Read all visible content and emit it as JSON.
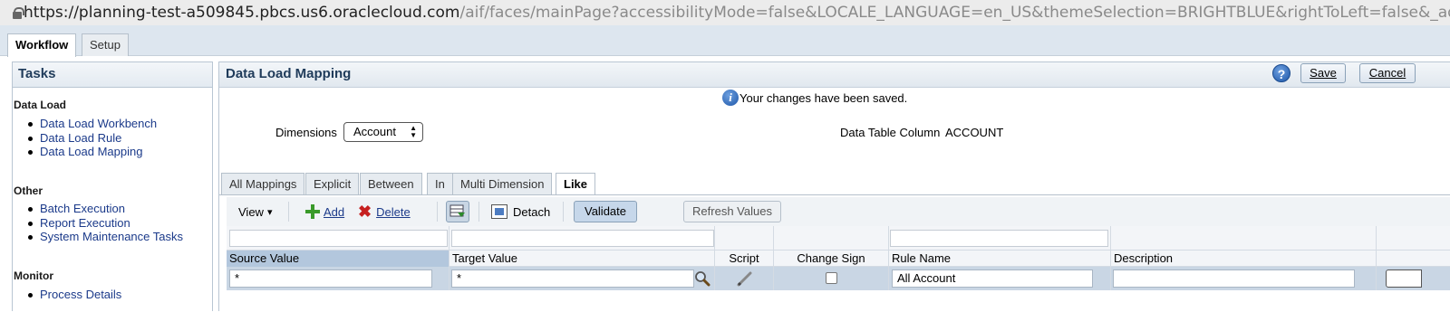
{
  "browser": {
    "url_host": "https://planning-test-a509845.pbcs.us6.oraclecloud.com",
    "url_path": "/aif/faces/mainPage?accessibilityMode=false&LOCALE_LANGUAGE=en_US&themeSelection=BRIGHTBLUE&rightToLeft=false&_adf.ctrl-s..."
  },
  "top_tabs": [
    {
      "label": "Workflow",
      "active": true
    },
    {
      "label": "Setup",
      "active": false
    }
  ],
  "tasks": {
    "title": "Tasks",
    "groups": [
      {
        "heading": "Data Load",
        "items": [
          "Data Load Workbench",
          "Data Load Rule",
          "Data Load Mapping"
        ]
      },
      {
        "heading": "Other",
        "items": [
          "Batch Execution",
          "Report Execution",
          "System Maintenance Tasks"
        ]
      },
      {
        "heading": "Monitor",
        "items": [
          "Process Details"
        ]
      }
    ]
  },
  "main": {
    "title": "Data Load Mapping",
    "help_icon": "?",
    "save_label": "Save",
    "cancel_label": "Cancel",
    "message": "Your changes have been saved.",
    "info_icon": "i",
    "dimensions_label": "Dimensions",
    "dimensions_value": "Account",
    "data_table_column_label": "Data Table Column",
    "data_table_column_value": "ACCOUNT"
  },
  "mapping_tabs": [
    {
      "label": "All Mappings",
      "active": false
    },
    {
      "label": "Explicit",
      "active": false
    },
    {
      "label": "Between",
      "active": false
    },
    {
      "label": "In",
      "active": false
    },
    {
      "label": "Multi Dimension",
      "active": false
    },
    {
      "label": "Like",
      "active": true
    }
  ],
  "toolbar": {
    "view_label": "View",
    "view_arrow": "▾",
    "add_label": "Add",
    "delete_label": "Delete",
    "delete_icon": "✖",
    "detach_label": "Detach",
    "validate_label": "Validate",
    "refresh_label": "Refresh Values"
  },
  "table": {
    "columns": [
      "Source Value",
      "Target Value",
      "Script",
      "Change Sign",
      "Rule Name",
      "Description"
    ],
    "rows": [
      {
        "source_value": "*",
        "target_value": "*",
        "change_sign": false,
        "rule_name": "All Account",
        "description": ""
      }
    ]
  },
  "colors": {
    "header_text": "#1f3b5a",
    "link": "#1b3a8a",
    "selected_row": "#c9d6e4",
    "sorted_header": "#b3c7dd"
  }
}
